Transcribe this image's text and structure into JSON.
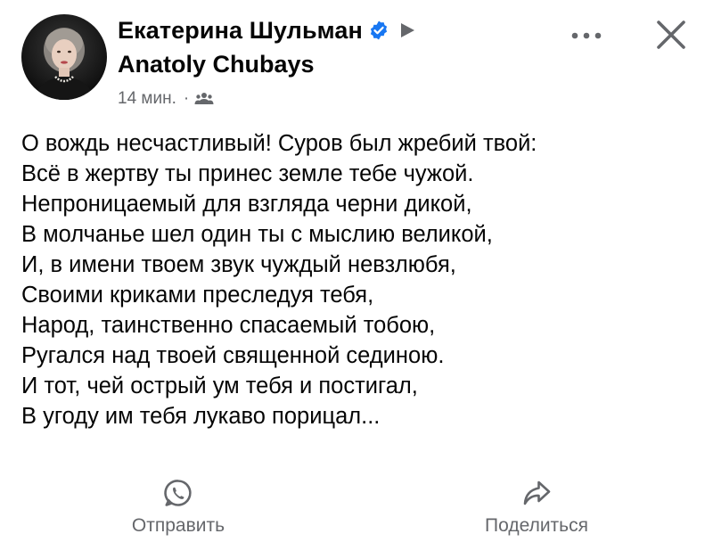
{
  "post": {
    "author": {
      "name": "Екатерина Шульман",
      "verified": true,
      "avatar_icon": "profile-photo"
    },
    "recipient": {
      "name": "Anatoly Chubays"
    },
    "meta": {
      "time": "14 мин.",
      "separator": "·",
      "audience_icon": "friends-icon"
    },
    "controls": {
      "more_icon": "more-horizontal-icon",
      "close_icon": "close-icon"
    },
    "text_lines": [
      "О вождь несчастливый! Суров был жребий твой:",
      "Всё в жертву ты принес земле тебе чужой.",
      "Непроницаемый для взгляда черни дикой,",
      "В молчанье шел один ты с мыслию великой,",
      "И, в имени твоем звук чуждый невзлюбя,",
      "Своими криками преследуя тебя,",
      "Народ, таинственно спасаемый тобою,",
      "Ругался над твоей священной сединою.",
      "И тот, чей острый ум тебя и постигал,",
      "В угоду им тебя лукаво порицал..."
    ],
    "actions": {
      "send_label": "Отправить",
      "send_icon": "whatsapp-icon",
      "share_label": "Поделиться",
      "share_icon": "share-arrow-icon"
    }
  },
  "colors": {
    "text_primary": "#050505",
    "text_secondary": "#65676b",
    "verified_blue": "#1877f2"
  }
}
